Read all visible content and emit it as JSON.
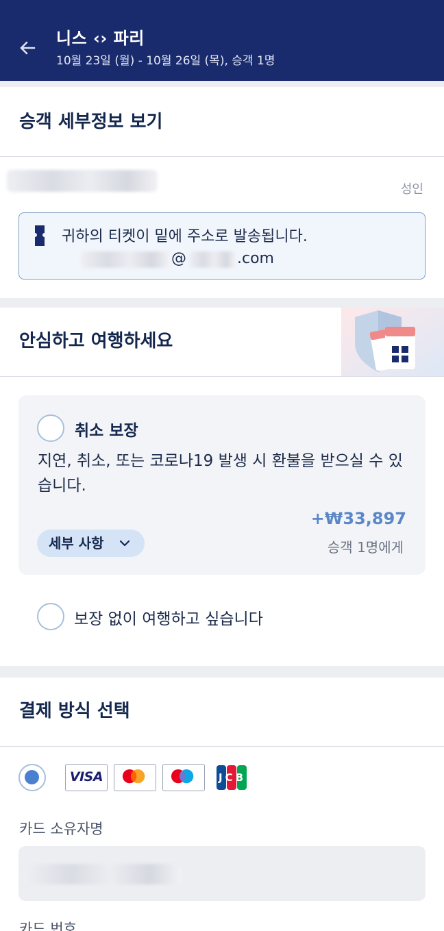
{
  "header": {
    "title": "니스 ‹› 파리",
    "subtitle": "10월 23일 (월) - 10월 26일 (목), 승객 1명"
  },
  "passenger": {
    "section_title": "승객 세부정보 보기",
    "type_label": "성인",
    "ticket_notice": "귀하의 티켓이 밑에 주소로 발송됩니다.",
    "email_at": "@",
    "email_suffix": ".com"
  },
  "insurance": {
    "section_title": "안심하고 여행하세요",
    "option_title": "취소 보장",
    "option_desc": "지연, 취소, 또는 코로나19 발생 시 환불을 받으실 수 있습니다.",
    "details_label": "세부 사항",
    "price": "+₩33,897",
    "per_passenger": "승객 1명에게",
    "no_insurance_label": "보장 없이 여행하고 싶습니다"
  },
  "payment": {
    "section_title": "결제 방식 선택",
    "visa_label": "VISA",
    "jcb_label": "JCB",
    "cardholder_label": "카드 소유자명",
    "card_number_label": "카드 번호"
  },
  "colors": {
    "header_bg": "#1a2b6d",
    "accent": "#4a80cf",
    "price": "#5b87c7"
  }
}
